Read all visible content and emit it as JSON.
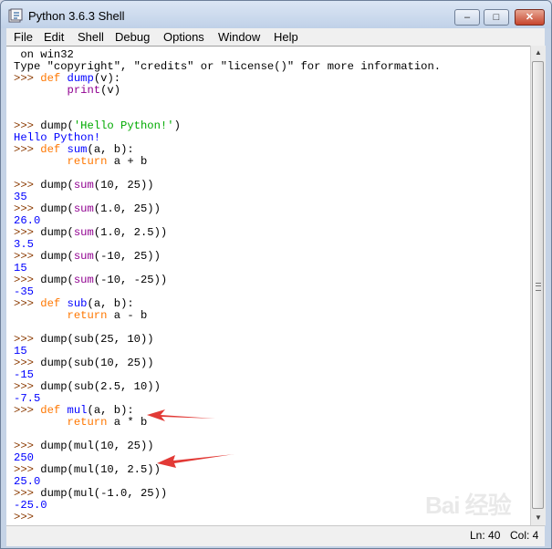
{
  "window": {
    "title": "Python 3.6.3 Shell"
  },
  "title_buttons": {
    "minimize": "–",
    "maximize": "□",
    "close": "✕"
  },
  "menu": [
    "File",
    "Edit",
    "Shell",
    "Debug",
    "Options",
    "Window",
    "Help"
  ],
  "shell_lines": [
    [
      {
        "t": " on win32",
        "c": ""
      }
    ],
    [
      {
        "t": "Type \"copyright\", \"credits\" or \"license()\" for more information.",
        "c": ""
      }
    ],
    [
      {
        "t": ">>> ",
        "c": "prompt"
      },
      {
        "t": "def",
        "c": "kw"
      },
      {
        "t": " ",
        "c": ""
      },
      {
        "t": "dump",
        "c": "fn"
      },
      {
        "t": "(v):",
        "c": ""
      }
    ],
    [
      {
        "t": "        ",
        "c": ""
      },
      {
        "t": "print",
        "c": "bi"
      },
      {
        "t": "(v)",
        "c": ""
      }
    ],
    [
      {
        "t": "",
        "c": ""
      }
    ],
    [
      {
        "t": "",
        "c": ""
      }
    ],
    [
      {
        "t": ">>> ",
        "c": "prompt"
      },
      {
        "t": "dump(",
        "c": ""
      },
      {
        "t": "'Hello Python!'",
        "c": "str"
      },
      {
        "t": ")",
        "c": ""
      }
    ],
    [
      {
        "t": "Hello Python!",
        "c": "out"
      }
    ],
    [
      {
        "t": ">>> ",
        "c": "prompt"
      },
      {
        "t": "def",
        "c": "kw"
      },
      {
        "t": " ",
        "c": ""
      },
      {
        "t": "sum",
        "c": "fn"
      },
      {
        "t": "(a, b):",
        "c": ""
      }
    ],
    [
      {
        "t": "        ",
        "c": ""
      },
      {
        "t": "return",
        "c": "kw"
      },
      {
        "t": " a + b",
        "c": ""
      }
    ],
    [
      {
        "t": "",
        "c": ""
      }
    ],
    [
      {
        "t": ">>> ",
        "c": "prompt"
      },
      {
        "t": "dump(",
        "c": ""
      },
      {
        "t": "sum",
        "c": "bi"
      },
      {
        "t": "(10, 25))",
        "c": ""
      }
    ],
    [
      {
        "t": "35",
        "c": "out"
      }
    ],
    [
      {
        "t": ">>> ",
        "c": "prompt"
      },
      {
        "t": "dump(",
        "c": ""
      },
      {
        "t": "sum",
        "c": "bi"
      },
      {
        "t": "(1.0, 25))",
        "c": ""
      }
    ],
    [
      {
        "t": "26.0",
        "c": "out"
      }
    ],
    [
      {
        "t": ">>> ",
        "c": "prompt"
      },
      {
        "t": "dump(",
        "c": ""
      },
      {
        "t": "sum",
        "c": "bi"
      },
      {
        "t": "(1.0, 2.5))",
        "c": ""
      }
    ],
    [
      {
        "t": "3.5",
        "c": "out"
      }
    ],
    [
      {
        "t": ">>> ",
        "c": "prompt"
      },
      {
        "t": "dump(",
        "c": ""
      },
      {
        "t": "sum",
        "c": "bi"
      },
      {
        "t": "(-10, 25))",
        "c": ""
      }
    ],
    [
      {
        "t": "15",
        "c": "out"
      }
    ],
    [
      {
        "t": ">>> ",
        "c": "prompt"
      },
      {
        "t": "dump(",
        "c": ""
      },
      {
        "t": "sum",
        "c": "bi"
      },
      {
        "t": "(-10, -25))",
        "c": ""
      }
    ],
    [
      {
        "t": "-35",
        "c": "out"
      }
    ],
    [
      {
        "t": ">>> ",
        "c": "prompt"
      },
      {
        "t": "def",
        "c": "kw"
      },
      {
        "t": " ",
        "c": ""
      },
      {
        "t": "sub",
        "c": "fn"
      },
      {
        "t": "(a, b):",
        "c": ""
      }
    ],
    [
      {
        "t": "        ",
        "c": ""
      },
      {
        "t": "return",
        "c": "kw"
      },
      {
        "t": " a - b",
        "c": ""
      }
    ],
    [
      {
        "t": "",
        "c": ""
      }
    ],
    [
      {
        "t": ">>> ",
        "c": "prompt"
      },
      {
        "t": "dump(sub(25, 10))",
        "c": ""
      }
    ],
    [
      {
        "t": "15",
        "c": "out"
      }
    ],
    [
      {
        "t": ">>> ",
        "c": "prompt"
      },
      {
        "t": "dump(sub(10, 25))",
        "c": ""
      }
    ],
    [
      {
        "t": "-15",
        "c": "out"
      }
    ],
    [
      {
        "t": ">>> ",
        "c": "prompt"
      },
      {
        "t": "dump(sub(2.5, 10))",
        "c": ""
      }
    ],
    [
      {
        "t": "-7.5",
        "c": "out"
      }
    ],
    [
      {
        "t": ">>> ",
        "c": "prompt"
      },
      {
        "t": "def",
        "c": "kw"
      },
      {
        "t": " ",
        "c": ""
      },
      {
        "t": "mul",
        "c": "fn"
      },
      {
        "t": "(a, b):",
        "c": ""
      }
    ],
    [
      {
        "t": "        ",
        "c": ""
      },
      {
        "t": "return",
        "c": "kw"
      },
      {
        "t": " a * b",
        "c": ""
      }
    ],
    [
      {
        "t": "",
        "c": ""
      }
    ],
    [
      {
        "t": ">>> ",
        "c": "prompt"
      },
      {
        "t": "dump(mul(10, 25))",
        "c": ""
      }
    ],
    [
      {
        "t": "250",
        "c": "out"
      }
    ],
    [
      {
        "t": ">>> ",
        "c": "prompt"
      },
      {
        "t": "dump(mul(10, 2.5))",
        "c": ""
      }
    ],
    [
      {
        "t": "25.0",
        "c": "out"
      }
    ],
    [
      {
        "t": ">>> ",
        "c": "prompt"
      },
      {
        "t": "dump(mul(-1.0, 25))",
        "c": ""
      }
    ],
    [
      {
        "t": "-25.0",
        "c": "out"
      }
    ],
    [
      {
        "t": ">>> ",
        "c": "prompt"
      }
    ]
  ],
  "status": {
    "line": "Ln: 40",
    "col": "Col: 4"
  },
  "colors": {
    "prompt": "#8b3a00",
    "keyword": "#ff7700",
    "defname": "#0000ff",
    "builtin": "#900090",
    "string": "#00aa00",
    "output": "#0000ff",
    "annotation_arrow": "#e23a36"
  },
  "icons": {
    "app": "python-idle-icon",
    "annotation": "red-arrow-icon"
  },
  "watermark": {
    "text": "Bai 经验"
  }
}
